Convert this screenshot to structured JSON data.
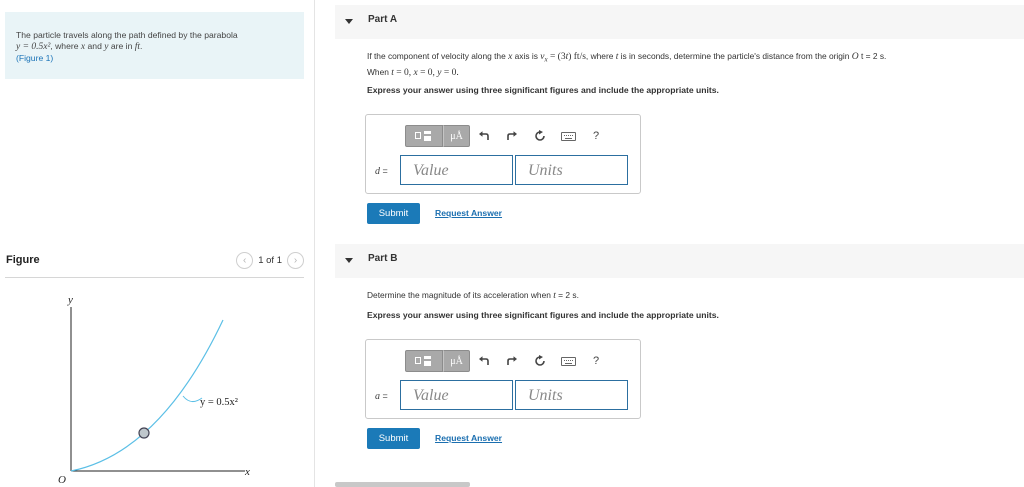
{
  "problem": {
    "intro": "The particle travels along the path defined by the parabola",
    "equation": "y = 0.5x²",
    "mid_text": ", where ",
    "var_x": "x",
    "and_text": " and ",
    "var_y": "y",
    "units_text": " are in ",
    "unit": "ft",
    "period": ".",
    "figure_link": "(Figure 1)"
  },
  "figure": {
    "title": "Figure",
    "pager_text": "1 of 1",
    "prev_icon": "chevron-left-icon",
    "next_icon": "chevron-right-icon",
    "axis_y": "y",
    "axis_x": "x",
    "origin": "O",
    "curve_label": "y = 0.5x²",
    "curve_color": "#5bbfe6",
    "particle_fill": "#bfc7cc"
  },
  "part_a": {
    "title": "Part A",
    "q1": "If the component of velocity along the ",
    "q_x": "x",
    "q2": " axis is ",
    "q_vx": "v",
    "q_vx_sub": "x",
    "q3": " = (3",
    "q_t": "t",
    "q4": ") ft/s",
    "q5": ", where ",
    "q_t2": "t",
    "q6": " is in seconds, determine the particle's distance from the origin ",
    "q_O": "O",
    "q7": " t = 2 s.",
    "q8": "When ",
    "q_t3": "t",
    "q9": " = 0, ",
    "q_x2": "x",
    "q10": " = 0, ",
    "q_y": "y",
    "q11": " = 0.",
    "instructions": "Express your answer using three significant figures and include the appropriate units.",
    "var_name": "d",
    "eq_sign": " =",
    "value_placeholder": "Value",
    "units_placeholder": "Units",
    "units_button": "μÅ",
    "help": "?",
    "submit": "Submit",
    "request": "Request Answer"
  },
  "part_b": {
    "title": "Part B",
    "q1": "Determine the magnitude of its acceleration when ",
    "q_t": "t",
    "q2": " = 2 s.",
    "instructions": "Express your answer using three significant figures and include the appropriate units.",
    "var_name": "a",
    "eq_sign": " =",
    "value_placeholder": "Value",
    "units_placeholder": "Units",
    "units_button": "μÅ",
    "help": "?",
    "submit": "Submit",
    "request": "Request Answer"
  },
  "colors": {
    "accent": "#1b7ab8",
    "problem_bg": "#e9f4f7",
    "part_header_bg": "#f6f6f6"
  }
}
